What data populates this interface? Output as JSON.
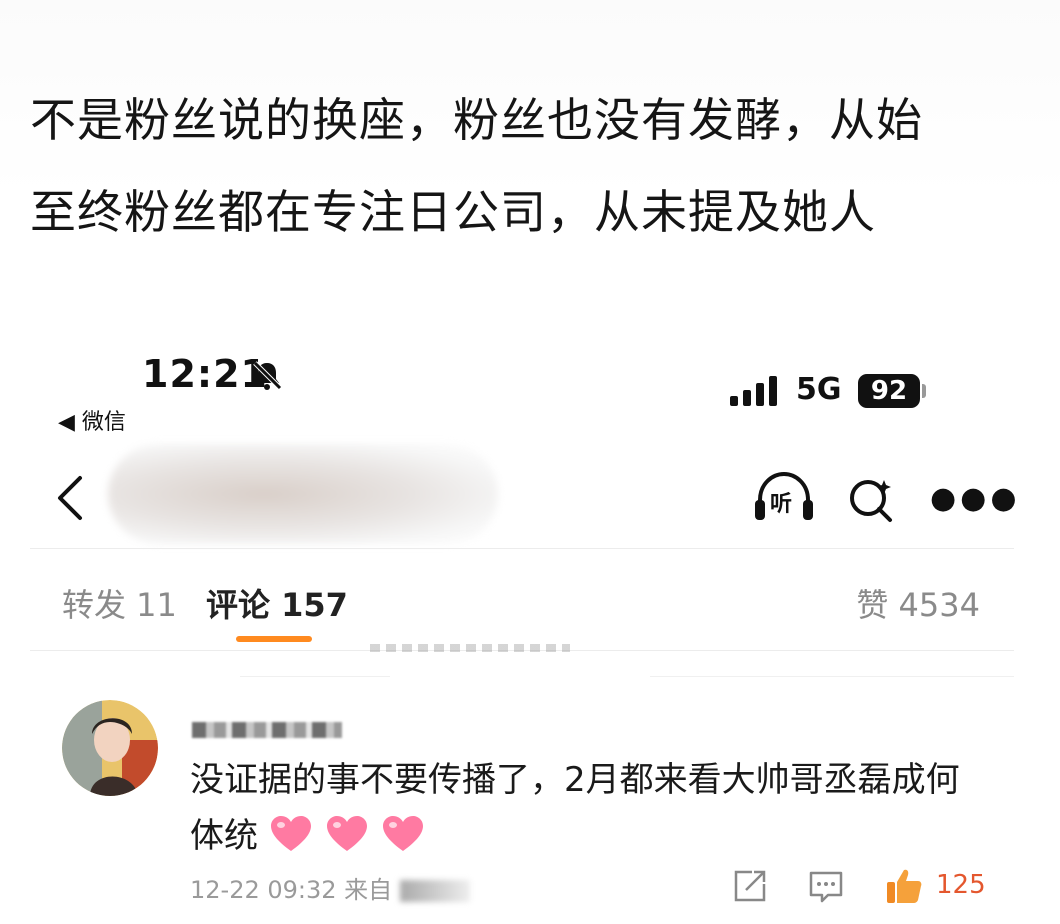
{
  "caption": {
    "line1": "不是粉丝说的换座，粉丝也没有发酵，从始",
    "line2": "至终粉丝都在专注日公司，从未提及她人"
  },
  "status_bar": {
    "time": "12:21",
    "back_app": "◀ 微信",
    "network": "5G",
    "battery": "92"
  },
  "nav": {
    "listen_label": "听"
  },
  "tabs": {
    "repost": "转发 11",
    "comment": "评论 157",
    "like": "赞 4534",
    "accent_color": "#ff8a1f"
  },
  "comment": {
    "text": "没证据的事不要传播了，2月都来看大帅哥丞磊成何体统",
    "meta": "12-22 09:32 来自",
    "like_count": "125",
    "like_color": "#e4572e"
  }
}
